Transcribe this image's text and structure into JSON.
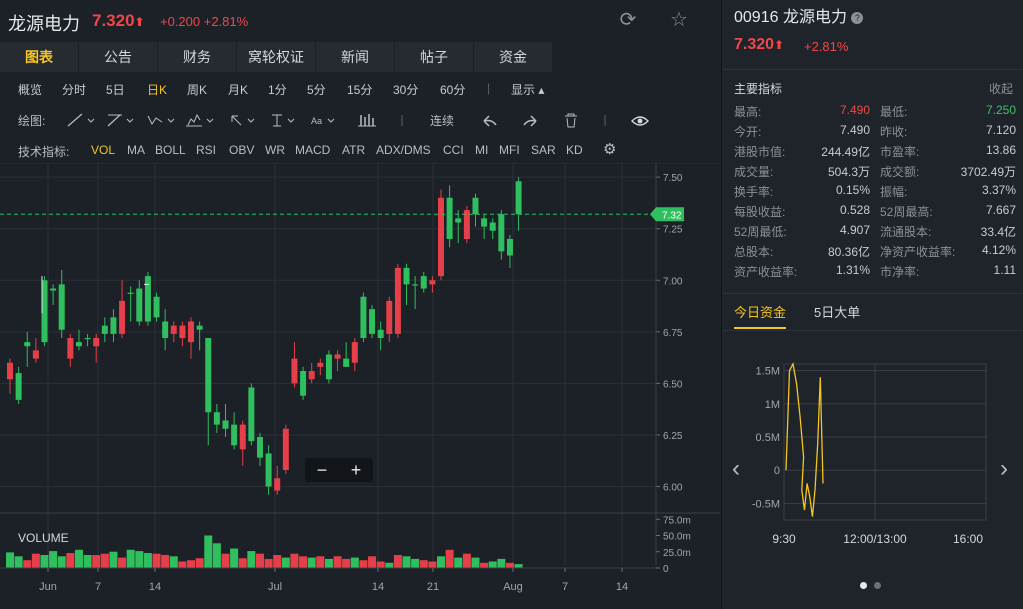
{
  "header": {
    "name": "龙源电力",
    "price": "7.320",
    "arrow": "⬆",
    "change": "+0.200 +2.81%"
  },
  "tabs": [
    "图表",
    "公告",
    "财务",
    "窝轮权证",
    "新闻",
    "帖子",
    "资金"
  ],
  "active_tab": 0,
  "periods": {
    "items": [
      "概览",
      "分时",
      "5日",
      "日K",
      "周K",
      "月K",
      "1分",
      "5分",
      "15分",
      "30分",
      "60分"
    ],
    "active": 3,
    "display": "显示"
  },
  "draw": {
    "label": "绘图:",
    "continuous": "连续"
  },
  "indicators": {
    "label": "技术指标:",
    "items": [
      "VOL",
      "MA",
      "BOLL",
      "RSI",
      "OBV",
      "WR",
      "MACD",
      "ATR",
      "ADX/DMS",
      "CCI",
      "MI",
      "MFI",
      "SAR",
      "KD"
    ],
    "active": 0
  },
  "chart_data": {
    "type": "candlestick",
    "ylim": [
      5.92,
      7.52
    ],
    "y_ticks": [
      "7.50",
      "7.25",
      "7.00",
      "6.75",
      "6.50",
      "6.25",
      "6.00"
    ],
    "current_price_label": "7.32",
    "current_price": 7.32,
    "x_ticks": [
      "Jun",
      "7",
      "14",
      "Jul",
      "14",
      "21",
      "Aug",
      "7",
      "14"
    ],
    "volume_label": "VOLUME",
    "volume_ticks": [
      "75.0m",
      "50.0m",
      "25.0m",
      "0"
    ],
    "volume_max": 80,
    "candles": [
      {
        "o": 6.6,
        "h": 6.62,
        "l": 6.45,
        "c": 6.52,
        "up": false
      },
      {
        "o": 6.42,
        "h": 6.58,
        "l": 6.4,
        "c": 6.55,
        "up": true
      },
      {
        "o": 6.68,
        "h": 6.75,
        "l": 6.58,
        "c": 6.7,
        "up": true
      },
      {
        "o": 6.66,
        "h": 6.72,
        "l": 6.6,
        "c": 6.62,
        "up": false
      },
      {
        "o": 6.7,
        "h": 7.02,
        "l": 6.68,
        "c": 7.0,
        "up": true
      },
      {
        "o": 6.95,
        "h": 6.98,
        "l": 6.88,
        "c": 6.96,
        "up": true
      },
      {
        "o": 6.98,
        "h": 7.05,
        "l": 6.72,
        "c": 6.76,
        "up": true
      },
      {
        "o": 6.72,
        "h": 6.74,
        "l": 6.58,
        "c": 6.62,
        "up": false
      },
      {
        "o": 6.68,
        "h": 6.76,
        "l": 6.66,
        "c": 6.7,
        "up": true
      },
      {
        "o": 6.72,
        "h": 6.74,
        "l": 6.68,
        "c": 6.72,
        "up": true
      },
      {
        "o": 6.68,
        "h": 6.74,
        "l": 6.6,
        "c": 6.72,
        "up": false
      },
      {
        "o": 6.78,
        "h": 6.82,
        "l": 6.7,
        "c": 6.74,
        "up": true
      },
      {
        "o": 6.74,
        "h": 6.86,
        "l": 6.7,
        "c": 6.82,
        "up": true
      },
      {
        "o": 6.9,
        "h": 7.0,
        "l": 6.72,
        "c": 6.74,
        "up": false
      },
      {
        "o": 6.94,
        "h": 6.97,
        "l": 6.8,
        "c": 6.94,
        "up": true
      },
      {
        "o": 6.96,
        "h": 7.0,
        "l": 6.78,
        "c": 6.8,
        "up": true
      },
      {
        "o": 6.8,
        "h": 7.04,
        "l": 6.78,
        "c": 7.02,
        "up": true
      },
      {
        "o": 6.92,
        "h": 6.94,
        "l": 6.8,
        "c": 6.82,
        "up": true
      },
      {
        "o": 6.8,
        "h": 6.86,
        "l": 6.66,
        "c": 6.72,
        "up": true
      },
      {
        "o": 6.78,
        "h": 6.8,
        "l": 6.7,
        "c": 6.74,
        "up": false
      },
      {
        "o": 6.72,
        "h": 6.8,
        "l": 6.68,
        "c": 6.78,
        "up": false
      },
      {
        "o": 6.8,
        "h": 6.82,
        "l": 6.62,
        "c": 6.7,
        "up": false
      },
      {
        "o": 6.78,
        "h": 6.8,
        "l": 6.66,
        "c": 6.76,
        "up": true
      },
      {
        "o": 6.72,
        "h": 6.72,
        "l": 6.2,
        "c": 6.36,
        "up": true
      },
      {
        "o": 6.36,
        "h": 6.4,
        "l": 6.26,
        "c": 6.3,
        "up": true
      },
      {
        "o": 6.32,
        "h": 6.4,
        "l": 6.24,
        "c": 6.28,
        "up": true
      },
      {
        "o": 6.2,
        "h": 6.36,
        "l": 6.18,
        "c": 6.3,
        "up": true
      },
      {
        "o": 6.3,
        "h": 6.32,
        "l": 6.1,
        "c": 6.18,
        "up": false
      },
      {
        "o": 6.48,
        "h": 6.5,
        "l": 6.2,
        "c": 6.22,
        "up": true
      },
      {
        "o": 6.24,
        "h": 6.26,
        "l": 6.1,
        "c": 6.14,
        "up": true
      },
      {
        "o": 6.0,
        "h": 6.2,
        "l": 5.96,
        "c": 6.16,
        "up": true
      },
      {
        "o": 6.04,
        "h": 6.1,
        "l": 5.96,
        "c": 5.98,
        "up": false
      },
      {
        "o": 6.08,
        "h": 6.3,
        "l": 6.06,
        "c": 6.28,
        "up": false
      },
      {
        "o": 6.5,
        "h": 6.7,
        "l": 6.48,
        "c": 6.62,
        "up": false
      },
      {
        "o": 6.56,
        "h": 6.58,
        "l": 6.42,
        "c": 6.44,
        "up": true
      },
      {
        "o": 6.56,
        "h": 6.6,
        "l": 6.5,
        "c": 6.52,
        "up": false
      },
      {
        "o": 6.58,
        "h": 6.62,
        "l": 6.54,
        "c": 6.6,
        "up": false
      },
      {
        "o": 6.52,
        "h": 6.66,
        "l": 6.5,
        "c": 6.64,
        "up": true
      },
      {
        "o": 6.62,
        "h": 6.66,
        "l": 6.56,
        "c": 6.64,
        "up": false
      },
      {
        "o": 6.62,
        "h": 6.7,
        "l": 6.58,
        "c": 6.58,
        "up": true
      },
      {
        "o": 6.6,
        "h": 6.72,
        "l": 6.56,
        "c": 6.7,
        "up": false
      },
      {
        "o": 6.72,
        "h": 6.94,
        "l": 6.7,
        "c": 6.92,
        "up": true
      },
      {
        "o": 6.86,
        "h": 6.88,
        "l": 6.72,
        "c": 6.74,
        "up": true
      },
      {
        "o": 6.76,
        "h": 6.8,
        "l": 6.66,
        "c": 6.72,
        "up": true
      },
      {
        "o": 6.74,
        "h": 6.92,
        "l": 6.7,
        "c": 6.9,
        "up": false
      },
      {
        "o": 6.74,
        "h": 7.08,
        "l": 6.72,
        "c": 7.06,
        "up": false
      },
      {
        "o": 6.98,
        "h": 7.08,
        "l": 6.88,
        "c": 7.06,
        "up": true
      },
      {
        "o": 6.98,
        "h": 7.02,
        "l": 6.86,
        "c": 6.98,
        "up": true
      },
      {
        "o": 7.02,
        "h": 7.04,
        "l": 6.94,
        "c": 6.96,
        "up": true
      },
      {
        "o": 7.0,
        "h": 7.02,
        "l": 6.94,
        "c": 6.98,
        "up": false
      },
      {
        "o": 7.02,
        "h": 7.44,
        "l": 7.0,
        "c": 7.4,
        "up": false
      },
      {
        "o": 7.4,
        "h": 7.46,
        "l": 7.16,
        "c": 7.2,
        "up": true
      },
      {
        "o": 7.28,
        "h": 7.34,
        "l": 7.18,
        "c": 7.3,
        "up": true
      },
      {
        "o": 7.2,
        "h": 7.36,
        "l": 7.18,
        "c": 7.34,
        "up": false
      },
      {
        "o": 7.4,
        "h": 7.42,
        "l": 7.26,
        "c": 7.32,
        "up": true
      },
      {
        "o": 7.3,
        "h": 7.32,
        "l": 7.2,
        "c": 7.26,
        "up": true
      },
      {
        "o": 7.28,
        "h": 7.3,
        "l": 7.2,
        "c": 7.24,
        "up": true
      },
      {
        "o": 7.32,
        "h": 7.34,
        "l": 7.1,
        "c": 7.14,
        "up": true
      },
      {
        "o": 7.2,
        "h": 7.22,
        "l": 7.06,
        "c": 7.12,
        "up": true
      },
      {
        "o": 7.32,
        "h": 7.5,
        "l": 7.24,
        "c": 7.48,
        "up": true
      }
    ],
    "volumes": [
      24,
      18,
      12,
      22,
      20,
      26,
      18,
      23,
      28,
      20,
      20,
      22,
      25,
      16,
      28,
      26,
      23,
      22,
      20,
      18,
      10,
      12,
      15,
      50,
      38,
      22,
      30,
      15,
      26,
      22,
      14,
      20,
      16,
      22,
      18,
      16,
      18,
      14,
      18,
      14,
      16,
      12,
      18,
      10,
      8,
      20,
      18,
      14,
      12,
      10,
      18,
      28,
      16,
      22,
      16,
      8,
      10,
      14,
      8,
      6
    ],
    "volume_up": [
      true,
      true,
      false,
      false,
      true,
      true,
      true,
      false,
      true,
      true,
      false,
      false,
      true,
      false,
      true,
      true,
      true,
      false,
      false,
      true,
      false,
      false,
      false,
      true,
      true,
      false,
      true,
      false,
      true,
      false,
      false,
      false,
      true,
      false,
      false,
      true,
      false,
      true,
      false,
      false,
      true,
      false,
      false,
      false,
      true,
      false,
      true,
      true,
      false,
      false,
      true,
      false,
      true,
      false,
      true,
      false,
      true,
      true,
      false,
      true
    ]
  },
  "right": {
    "code_name": "00916 龙源电力",
    "price": "7.320",
    "arrow": "⬆",
    "change": "+2.81%",
    "section": "主要指标",
    "fold": "收起",
    "stats": [
      [
        "最高:",
        "7.490",
        "最低:",
        "7.250"
      ],
      [
        "今开:",
        "7.490",
        "昨收:",
        "7.120"
      ],
      [
        "港股市值:",
        "244.49亿",
        "市盈率:",
        "13.86"
      ],
      [
        "成交量:",
        "504.3万",
        "成交额:",
        "3702.49万"
      ],
      [
        "换手率:",
        "0.15%",
        "振幅:",
        "3.37%"
      ],
      [
        "每股收益:",
        "0.528",
        "52周最高:",
        "7.667"
      ],
      [
        "52周最低:",
        "4.907",
        "流通股本:",
        "33.4亿"
      ],
      [
        "总股本:",
        "80.36亿",
        "净资产收益率:",
        "4.12%"
      ],
      [
        "资产收益率:",
        "1.31%",
        "市净率:",
        "1.11"
      ]
    ],
    "fund_tabs": [
      "今日资金",
      "5日大单"
    ],
    "fund_chart": {
      "y_ticks": [
        "1.5M",
        "1M",
        "0.5M",
        "0",
        "-0.5M"
      ],
      "x_ticks": [
        "9:30",
        "12:00/13:00",
        "16:00"
      ],
      "ylim": [
        -0.75,
        1.6
      ],
      "series": [
        0.0,
        1.5,
        1.6,
        1.3,
        0.8,
        0.2,
        -0.3,
        -0.6,
        -0.2,
        -0.4,
        -0.7,
        -0.3,
        0.4,
        1.4,
        -0.2
      ]
    }
  }
}
